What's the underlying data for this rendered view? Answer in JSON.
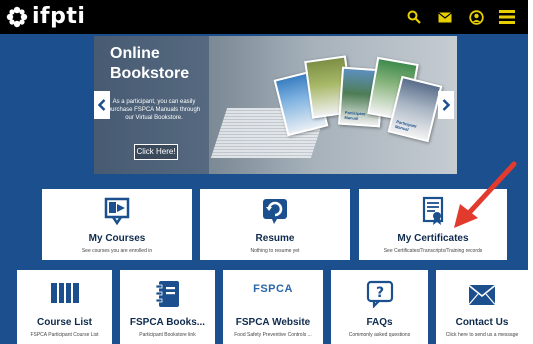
{
  "header": {
    "logo_text": "ifpti",
    "icons": [
      "search-icon",
      "mail-icon",
      "user-icon",
      "menu-icon"
    ],
    "icon_color": "#e8d000",
    "background": "#000000"
  },
  "banner": {
    "title_line1": "Online",
    "title_line2": "Bookstore",
    "description": "As a participant, you can easily purchase FSPCA Manuals through our Virtual Bookstore.",
    "button_label": "Click Here!",
    "book_label": "Participant Manual"
  },
  "tiles_row1": [
    {
      "title": "My Courses",
      "subtitle": "See courses you are enrolled in",
      "icon": "courses-icon"
    },
    {
      "title": "Resume",
      "subtitle": "Nothing to resume yet",
      "icon": "resume-icon"
    },
    {
      "title": "My Certificates",
      "subtitle": "See Certificates/Transcripts/Training records",
      "icon": "certificate-icon"
    }
  ],
  "tiles_row2": [
    {
      "title": "Course List",
      "subtitle": "FSPCA Participant Course List",
      "icon": "book-open-icon"
    },
    {
      "title": "FSPCA Books...",
      "subtitle": "Participant Bookstore link",
      "icon": "notebook-icon"
    },
    {
      "title": "FSPCA Website",
      "subtitle": "Food Safety Preventive Controls ...",
      "icon": "fspca-logo",
      "logo_text": "FSPCA"
    },
    {
      "title": "FAQs",
      "subtitle": "Commonly asked questions",
      "icon": "help-chat-icon"
    },
    {
      "title": "Contact Us",
      "subtitle": "Click here to send us a message",
      "icon": "envelope-icon"
    }
  ],
  "colors": {
    "brand_blue": "#1b4f8e",
    "tile_text": "#0f2b4d",
    "annotation_red": "#e23b2e"
  }
}
